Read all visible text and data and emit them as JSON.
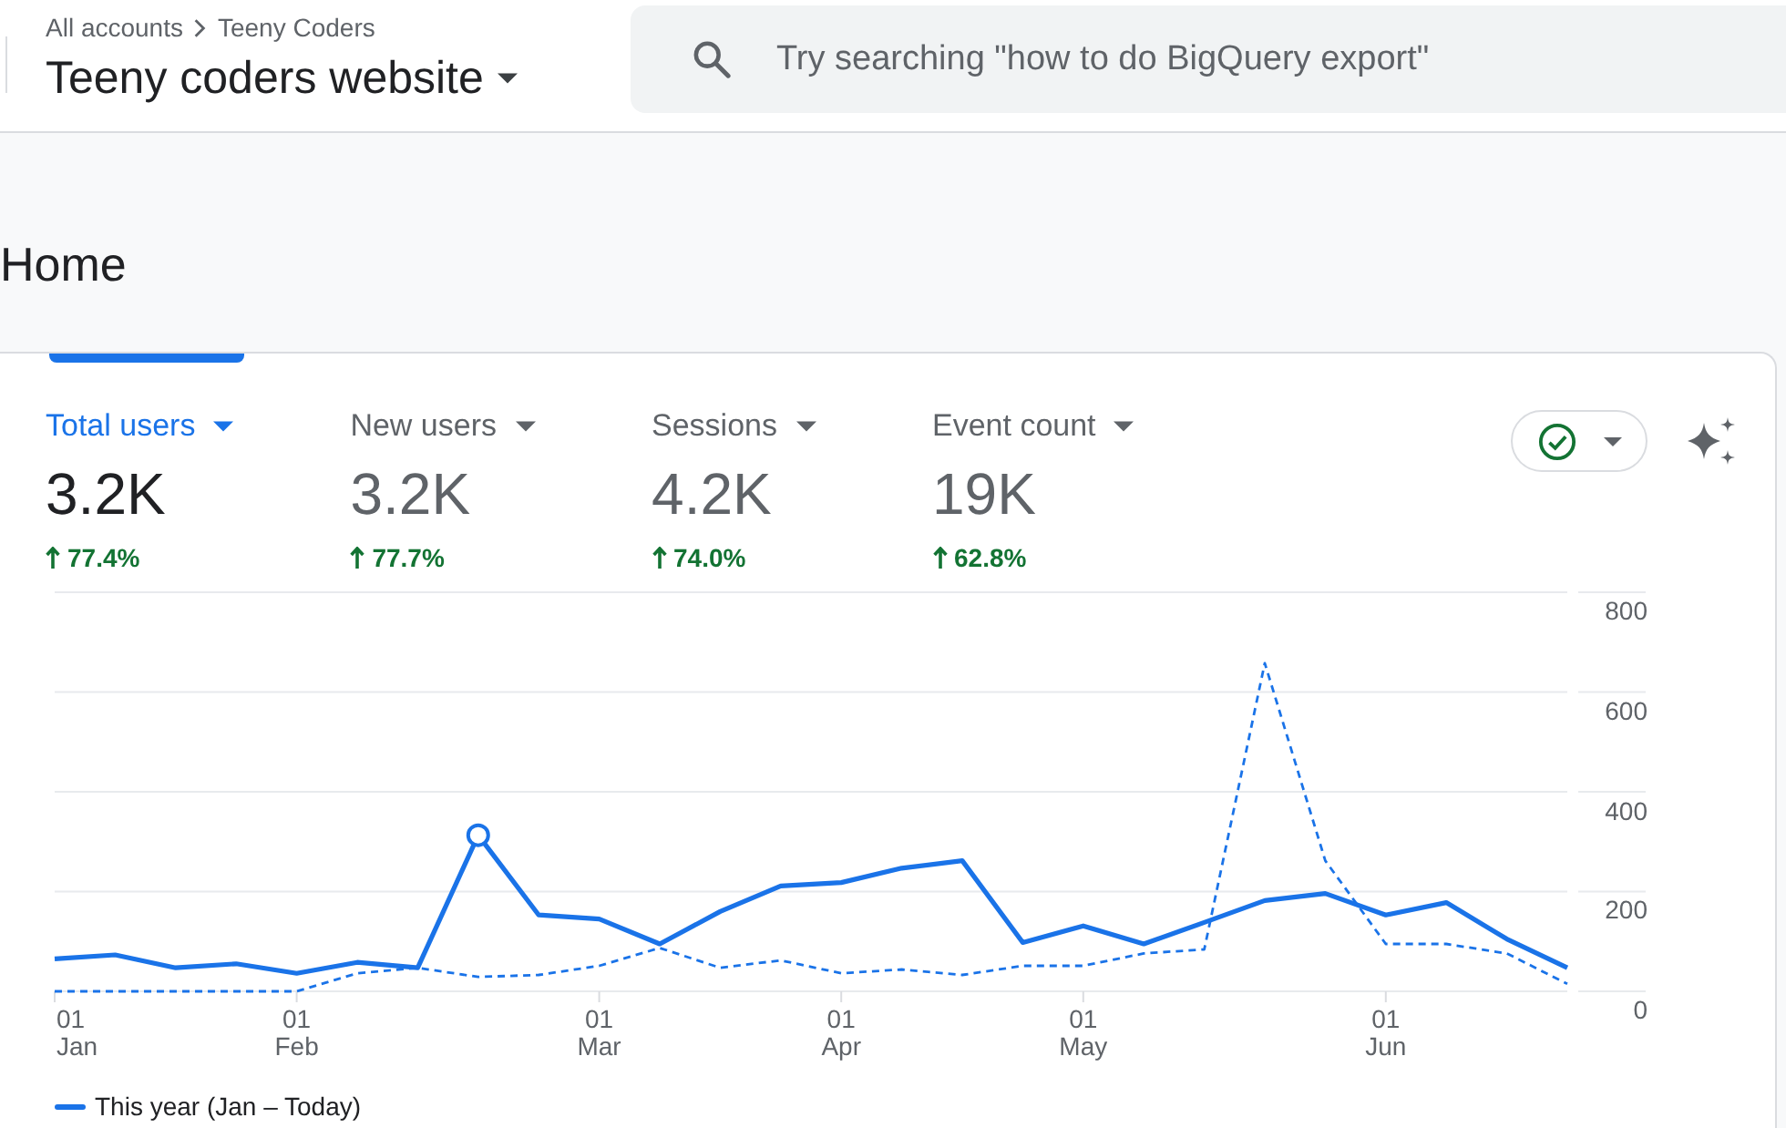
{
  "header": {
    "breadcrumb": [
      "All accounts",
      "Teeny Coders"
    ],
    "property": "Teeny coders website",
    "search": {
      "placeholder": "Try searching \"how to do BigQuery export\""
    }
  },
  "page": {
    "title": "Home"
  },
  "card": {
    "metrics": [
      {
        "label": "Total users",
        "value": "3.2K",
        "change": "77.4%",
        "rising": true,
        "selected": true
      },
      {
        "label": "New users",
        "value": "3.2K",
        "change": "77.7%",
        "rising": true,
        "selected": false
      },
      {
        "label": "Sessions",
        "value": "4.2K",
        "change": "74.0%",
        "rising": true,
        "selected": false
      },
      {
        "label": "Event count",
        "value": "19K",
        "change": "62.8%",
        "rising": true,
        "selected": false
      }
    ],
    "chart": {
      "chart_data": {
        "type": "line",
        "grid": true,
        "categories": [
          "01\nJan",
          null,
          null,
          null,
          "01\nFeb",
          null,
          null,
          null,
          null,
          "01\nMar",
          null,
          null,
          null,
          "01\nApr",
          null,
          null,
          null,
          "01\nMay",
          null,
          null,
          null,
          null,
          "01\nJun",
          null,
          null,
          null
        ],
        "series": [
          {
            "name": "This year (Jan – Today)",
            "color": "#1a73e8",
            "line_style": "solid",
            "values": [
              65,
              73,
              47,
              55,
              36,
              58,
              47,
              313,
              153,
              145,
              95,
              160,
              211,
              218,
              247,
              262,
              98,
              131,
              95,
              138,
              182,
              196,
              153,
              178,
              105,
              47
            ]
          },
          {
            "color": "#1a73e8",
            "line_style": "dashed",
            "values": [
              0,
              0,
              0,
              0,
              0,
              36,
              47,
              29,
              33,
              51,
              87,
              47,
              62,
              36,
              44,
              33,
              51,
              51,
              76,
              84,
              658,
              262,
              95,
              95,
              76,
              15
            ]
          }
        ],
        "ylim": [
          0,
          800
        ],
        "yticks": [
          0,
          200,
          400,
          600,
          800
        ]
      }
    }
  }
}
